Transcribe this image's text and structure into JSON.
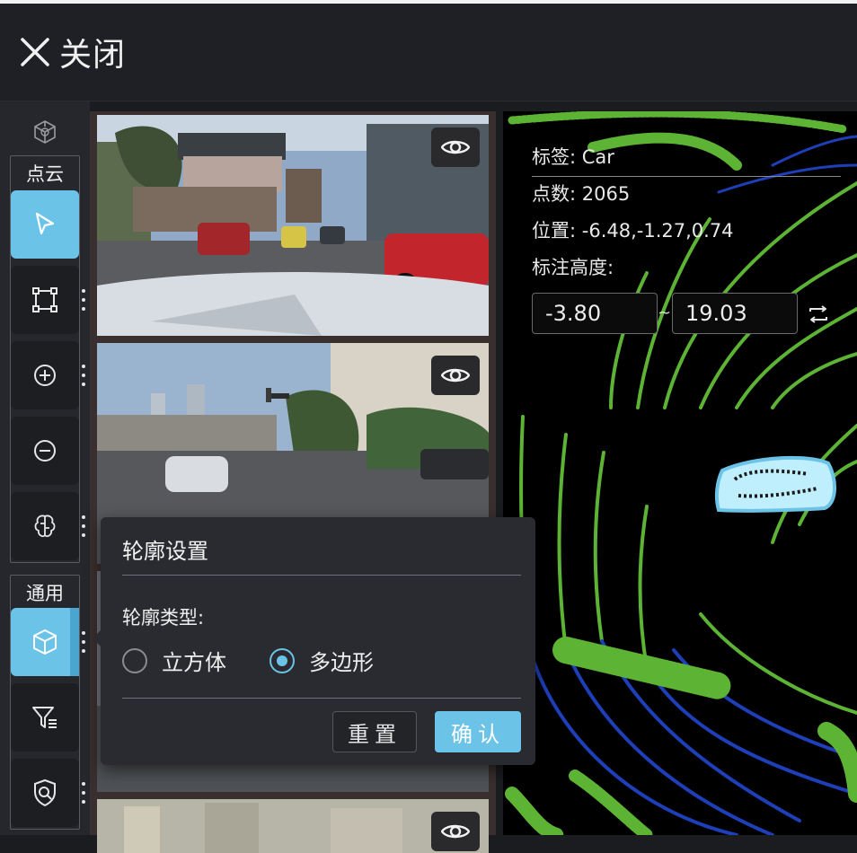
{
  "header": {
    "close_label": "关闭"
  },
  "toolbar": {
    "pointcloud_title": "点云",
    "general_title": "通用"
  },
  "info": {
    "label_key": "标签:",
    "label_value": "Car",
    "points_key": "点数:",
    "points_value": "2065",
    "position_key": "位置:",
    "position_value": "-6.48,-1.27,0.74",
    "height_key": "标注高度:",
    "height_min": "-3.80",
    "height_max": "19.03",
    "tilde": "~"
  },
  "popup": {
    "title": "轮廓设置",
    "type_label": "轮廓类型:",
    "option_cube": "立方体",
    "option_polygon": "多边形",
    "selected": "多边形",
    "reset_label": "重置",
    "confirm_label": "确认"
  },
  "colors": {
    "accent": "#6cc3e8",
    "lidar_green": "#5db334",
    "lidar_blue": "#1f3fb8"
  }
}
